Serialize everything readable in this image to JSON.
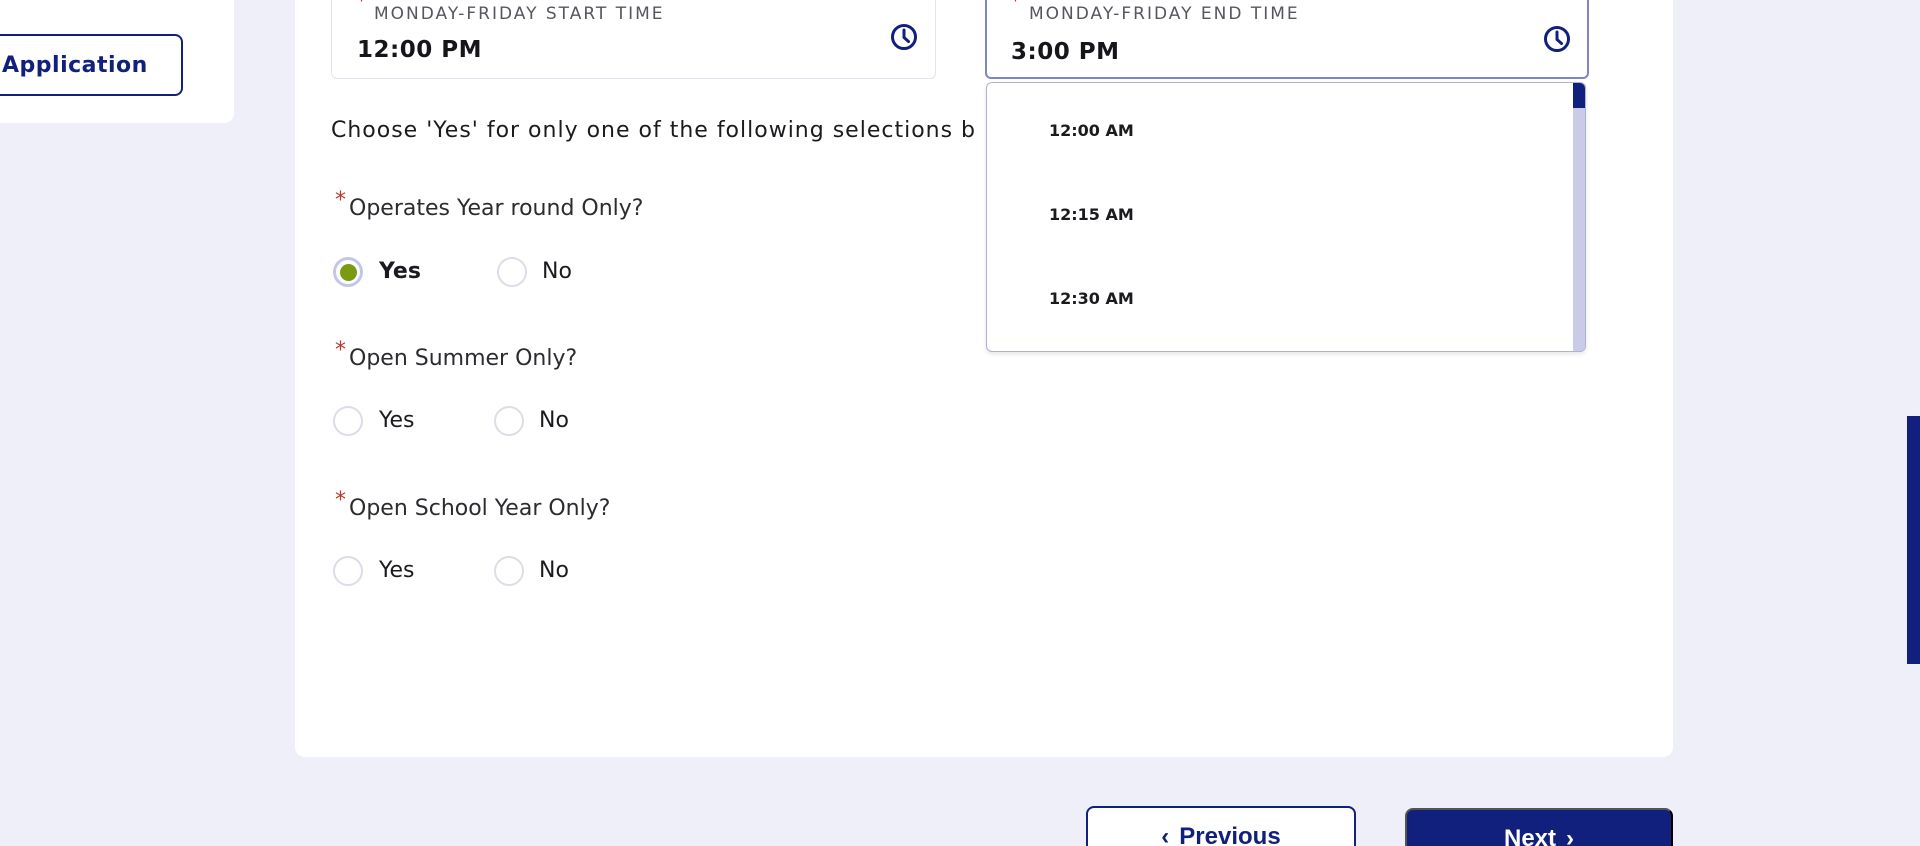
{
  "sidebar": {
    "application_button": "Application"
  },
  "hours": {
    "start": {
      "required_mark": "*",
      "label": "MONDAY-FRIDAY START TIME",
      "value": "12:00 PM",
      "icon": "clock-icon"
    },
    "end": {
      "required_mark": "*",
      "label": "MONDAY-FRIDAY END TIME",
      "value": "3:00 PM",
      "icon": "clock-icon"
    },
    "dropdown_options": [
      "12:00 AM",
      "12:15 AM",
      "12:30 AM"
    ]
  },
  "instruction": "Choose 'Yes' for only one of the following selections b",
  "questions": [
    {
      "required_mark": "*",
      "text": "Operates Year round Only?",
      "yes": "Yes",
      "no": "No",
      "selected": "Yes"
    },
    {
      "required_mark": "*",
      "text": "Open Summer Only?",
      "yes": "Yes",
      "no": "No",
      "selected": null
    },
    {
      "required_mark": "*",
      "text": "Open School Year Only?",
      "yes": "Yes",
      "no": "No",
      "selected": null
    }
  ],
  "navigation": {
    "previous": "Previous",
    "next": "Next"
  },
  "colors": {
    "brand": "#11207d",
    "selected_radio": "#7a9a12",
    "required": "#c0392b",
    "background": "#eeeff8"
  }
}
